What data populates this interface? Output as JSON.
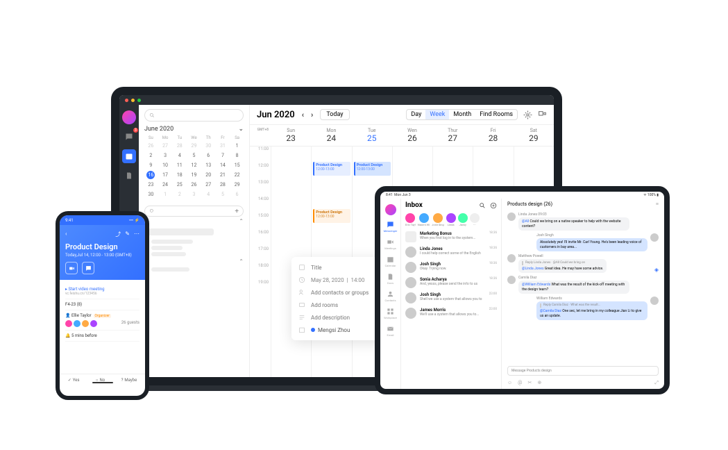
{
  "laptop": {
    "cal": {
      "title": "Jun 2020",
      "today_btn": "Today",
      "views": {
        "day": "Day",
        "week": "Week",
        "month": "Month",
        "find": "Find Rooms"
      },
      "tz": "GMT+8",
      "week": [
        {
          "d": "Sun",
          "n": "23"
        },
        {
          "d": "Mon",
          "n": "24"
        },
        {
          "d": "Tue",
          "n": "25"
        },
        {
          "d": "Wen",
          "n": "26"
        },
        {
          "d": "Thur",
          "n": "27"
        },
        {
          "d": "Fri",
          "n": "28"
        },
        {
          "d": "Sat",
          "n": "29"
        }
      ],
      "times": [
        "11:00",
        "12:00",
        "13:00",
        "14:00",
        "15:00",
        "16:00",
        "17:00",
        "18:00",
        "19:00"
      ],
      "events": {
        "pd1": {
          "name": "Product Design",
          "time": "12:00-13:00"
        },
        "pd2": {
          "name": "Product Design",
          "time": "12:00-13:00"
        },
        "pd3": {
          "name": "Product Design",
          "time": "12:00-13:00"
        }
      }
    },
    "mini": {
      "month": "June 2020",
      "dow": [
        "Su",
        "Mo",
        "Tu",
        "We",
        "Th",
        "Fr",
        "Sa"
      ],
      "selected": 16
    },
    "rail_badge": "3",
    "popup": {
      "title_ph": "Title",
      "date": "May 28, 2020",
      "time": "14:00",
      "contacts_ph": "Add contacts or groups",
      "rooms_ph": "Add rooms",
      "desc_ph": "Add description",
      "organizer": "Mengsi Zhou"
    }
  },
  "phone": {
    "time": "9:41",
    "title": "Product Design",
    "subtitle": "Today,Jul 14, 12:00 - 13:00 (GMT+8)",
    "video_label": "Start video meeting",
    "video_sub": "vc.feishu.cn/123456",
    "room": "F4-23 (8)",
    "organizer": "Ellie Taylor",
    "organizer_tag": "Organizer",
    "guests_label": "26 guests",
    "reminder": "5 mins before",
    "footer": {
      "yes": "Yes",
      "no": "No",
      "maybe": "Maybe"
    }
  },
  "tablet": {
    "status": {
      "time": "8:41",
      "date": "Mon Jun 3",
      "wifi": "100%"
    },
    "rail": [
      "Messenger",
      "Meetings",
      "Calendar",
      "Docs",
      "Contacts",
      "Workplace",
      "Email"
    ],
    "inbox": "Inbox",
    "stories": [
      {
        "n": "Eric Tay!"
      },
      {
        "n": "Naomi Wi"
      },
      {
        "n": "Josh Sing"
      },
      {
        "n": "Linda"
      },
      {
        "n": "Jacky"
      }
    ],
    "convs": [
      {
        "name": "Marketing Bonus",
        "sub": "When you first log in to the system...",
        "time": "18:36",
        "grp": true
      },
      {
        "name": "Linda Jones",
        "sub": "I could help correct some of the English",
        "time": "18:36"
      },
      {
        "name": "Josh Singh",
        "sub": "Okay. Trying now.",
        "time": "18:36"
      },
      {
        "name": "Sonia Acharya",
        "sub": "And, yesss, please send the info to us",
        "time": "18:36"
      },
      {
        "name": "Josh Singh",
        "sub": "Shell we use a system that allows you to",
        "time": "23:00"
      },
      {
        "name": "James Morris",
        "sub": "We'll use a system that allows you to...",
        "time": "23:00"
      }
    ],
    "chat": {
      "title": "Products design (26)",
      "msgs": [
        {
          "who": "Linda Jones",
          "t": "09:03",
          "own": false,
          "text": "@All Could we bring on a native speaker to help with the website content?",
          "mention": "@All "
        },
        {
          "who": "Josh Singh",
          "own": true,
          "text": "Absolutely yes! I'll invite Mr. Carl Young. He's been leading voice of customers in bay area..."
        },
        {
          "who": "Matthew Powell",
          "own": false,
          "reply": "Reply Linda Jones · @All Could we bring on",
          "text": "@Linda Jones Great idea. He may have some advice.",
          "mention": "@Linda Jones "
        },
        {
          "who": "Camila Diaz",
          "own": false,
          "text": "@William Edwards What was the result of the kick-off meeting with the design team?",
          "mention": "@William Edwards "
        },
        {
          "who": "William Edwards",
          "own": true,
          "reply": "Reply Camila Diaz · What was the result...",
          "text": "@Camila Diaz One sec, let me bring in my colleague Jian Li to give us an update.",
          "mention": "@Camila Diaz "
        }
      ],
      "input_ph": "Message Products design"
    }
  }
}
